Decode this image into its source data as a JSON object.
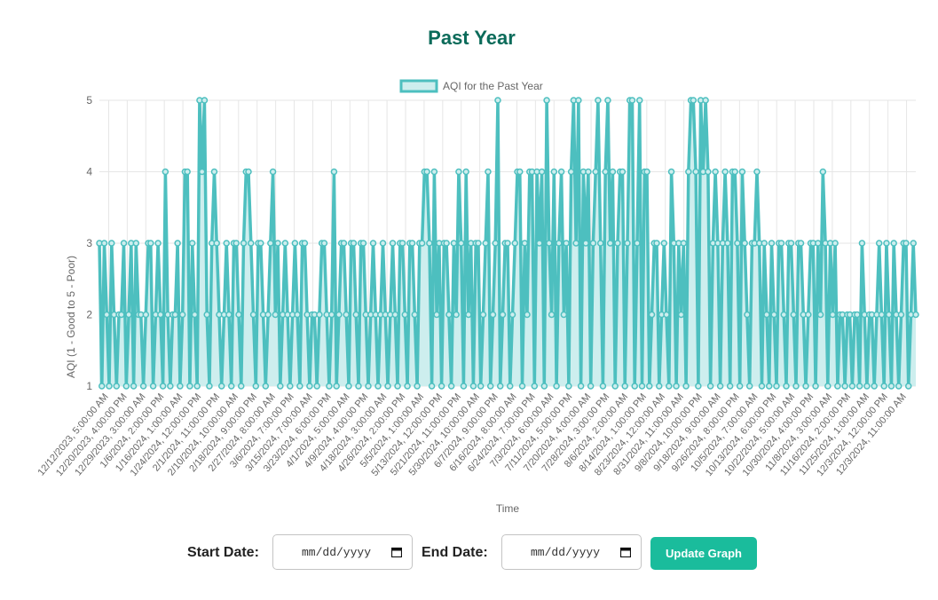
{
  "page": {
    "title": "Past Year"
  },
  "controls": {
    "start_label": "Start Date:",
    "start_value": "mm/dd/yyyy",
    "end_label": "End Date:",
    "end_value": "mm/dd/yyyy",
    "update_button": "Update Graph",
    "button_color": "#1abc9c"
  },
  "chart_data": {
    "type": "line",
    "title": "",
    "xlabel": "Time",
    "ylabel": "AQI (1 - Good to 5 - Poor)",
    "ylim": [
      1,
      5
    ],
    "yticks": [
      1,
      2,
      3,
      4,
      5
    ],
    "grid": true,
    "legend_position": "top",
    "line_color": "#4dbfbf",
    "fill_color": "#cdeeee",
    "series": [
      {
        "name": "AQI for the Past Year",
        "values": [
          3,
          1,
          3,
          2,
          1,
          3,
          2,
          1,
          2,
          2,
          3,
          1,
          2,
          3,
          1,
          3,
          2,
          2,
          1,
          2,
          3,
          3,
          1,
          2,
          3,
          2,
          1,
          4,
          2,
          1,
          2,
          2,
          3,
          1,
          2,
          4,
          4,
          1,
          3,
          2,
          1,
          5,
          4,
          5,
          2,
          1,
          3,
          4,
          3,
          2,
          1,
          2,
          3,
          2,
          1,
          3,
          3,
          2,
          1,
          3,
          4,
          4,
          3,
          2,
          1,
          3,
          3,
          2,
          1,
          2,
          3,
          4,
          2,
          3,
          1,
          2,
          3,
          2,
          1,
          2,
          3,
          2,
          1,
          3,
          3,
          2,
          1,
          2,
          2,
          1,
          2,
          3,
          3,
          2,
          1,
          2,
          4,
          1,
          2,
          3,
          3,
          2,
          1,
          3,
          3,
          2,
          1,
          3,
          3,
          2,
          1,
          2,
          3,
          2,
          1,
          2,
          3,
          2,
          1,
          2,
          3,
          2,
          1,
          3,
          3,
          2,
          1,
          3,
          3,
          2,
          1,
          3,
          3,
          4,
          4,
          3,
          1,
          4,
          2,
          3,
          1,
          3,
          3,
          2,
          1,
          3,
          2,
          4,
          3,
          1,
          4,
          2,
          3,
          1,
          3,
          3,
          1,
          2,
          3,
          4,
          1,
          2,
          3,
          5,
          1,
          2,
          3,
          3,
          1,
          2,
          3,
          4,
          4,
          1,
          3,
          2,
          4,
          4,
          1,
          4,
          3,
          4,
          1,
          5,
          3,
          2,
          4,
          1,
          3,
          4,
          2,
          3,
          1,
          4,
          5,
          3,
          5,
          1,
          4,
          3,
          4,
          1,
          3,
          4,
          5,
          3,
          1,
          4,
          5,
          3,
          4,
          1,
          3,
          4,
          4,
          1,
          3,
          5,
          5,
          1,
          3,
          5,
          1,
          4,
          4,
          1,
          2,
          3,
          3,
          1,
          2,
          3,
          2,
          1,
          4,
          3,
          1,
          3,
          2,
          3,
          1,
          4,
          5,
          5,
          4,
          1,
          5,
          4,
          5,
          4,
          1,
          3,
          4,
          3,
          1,
          3,
          4,
          3,
          1,
          4,
          4,
          3,
          1,
          4,
          3,
          2,
          1,
          3,
          3,
          4,
          3,
          1,
          3,
          2,
          1,
          3,
          2,
          1,
          3,
          3,
          2,
          1,
          3,
          3,
          2,
          1,
          3,
          3,
          2,
          1,
          2,
          3,
          3,
          1,
          3,
          2,
          4,
          3,
          1,
          3,
          2,
          3,
          1,
          2,
          2,
          1,
          2,
          2,
          1,
          2,
          2,
          1,
          3,
          2,
          1,
          2,
          2,
          1,
          2,
          3,
          2,
          1,
          3,
          2,
          1,
          3,
          2,
          1,
          2,
          3,
          3,
          1,
          2,
          3,
          2
        ]
      }
    ],
    "categories": [
      "12/12/2023, 5:00:00 AM",
      "12/20/2023, 4:00:00 PM",
      "12/29/2023, 3:00:00 AM",
      "1/6/2024, 2:00:00 PM",
      "1/16/2024, 1:00:00 AM",
      "1/24/2024, 12:00:00 PM",
      "2/1/2024, 11:00:00 PM",
      "2/10/2024, 10:00:00 AM",
      "2/18/2024, 9:00:00 PM",
      "2/27/2024, 8:00:00 AM",
      "3/6/2024, 7:00:00 PM",
      "3/15/2024, 7:00:00 AM",
      "3/23/2024, 6:00:00 PM",
      "4/1/2024, 5:00:00 AM",
      "4/9/2024, 4:00:00 PM",
      "4/18/2024, 3:00:00 AM",
      "4/26/2024, 2:00:00 PM",
      "5/5/2024, 1:00:00 AM",
      "5/13/2024, 12:00:00 PM",
      "5/21/2024, 11:00:00 PM",
      "5/30/2024, 10:00:00 AM",
      "6/7/2024, 9:00:00 PM",
      "6/16/2024, 8:00:00 AM",
      "6/24/2024, 7:00:00 PM",
      "7/3/2024, 6:00:00 AM",
      "7/11/2024, 5:00:00 PM",
      "7/20/2024, 4:00:00 AM",
      "7/28/2024, 3:00:00 PM",
      "8/6/2024, 2:00:00 AM",
      "8/14/2024, 1:00:00 PM",
      "8/23/2024, 12:00:00 AM",
      "8/31/2024, 11:00:00 AM",
      "9/8/2024, 10:00:00 PM",
      "9/18/2024, 9:00:00 AM",
      "9/26/2024, 8:00:00 PM",
      "10/5/2024, 7:00:00 AM",
      "10/13/2024, 6:00:00 PM",
      "10/22/2024, 5:00:00 AM",
      "10/30/2024, 4:00:00 PM",
      "11/8/2024, 3:00:00 AM",
      "11/16/2024, 2:00:00 PM",
      "11/25/2024, 1:00:00 AM",
      "12/3/2024, 12:00:00 PM",
      "12/3/2024, 11:00:00 AM"
    ]
  }
}
